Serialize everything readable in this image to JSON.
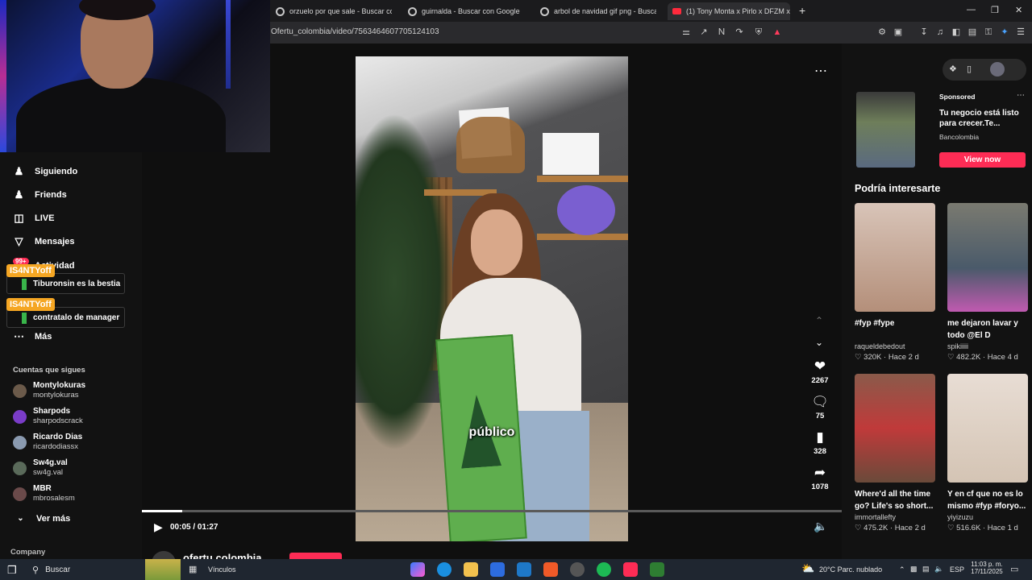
{
  "browser": {
    "tabs": [
      {
        "label": "orzuelo por que sale - Buscar con Go",
        "icon": "google-icon"
      },
      {
        "label": "guirnalda - Buscar con Google",
        "icon": "google-icon"
      },
      {
        "label": "arbol de navidad gif png - Buscar co",
        "icon": "google-icon"
      },
      {
        "label": "(1) Tony Monta x Pirlo x DFZM x Top",
        "icon": "youtube-icon"
      }
    ],
    "new_tab": "+",
    "url": "Ofertu_colombia/video/7563464607705124103"
  },
  "sidebar": {
    "nav": [
      {
        "label": "Siguiendo",
        "icon": "following-icon"
      },
      {
        "label": "Friends",
        "icon": "friends-icon"
      },
      {
        "label": "LIVE",
        "icon": "live-icon"
      },
      {
        "label": "Mensajes",
        "icon": "messages-icon"
      },
      {
        "label": "Actividad",
        "icon": "activity-icon",
        "badge": "99+"
      },
      {
        "label": "Más",
        "icon": "more-icon"
      }
    ],
    "following_label": "Cuentas que sigues",
    "following": [
      {
        "name": "Montylokuras",
        "handle": "montylokuras"
      },
      {
        "name": "Sharpods",
        "handle": "sharpodscrack"
      },
      {
        "name": "Ricardo Dias",
        "handle": "ricardodiassx"
      },
      {
        "name": "Sw4g.val",
        "handle": "sw4g.val"
      },
      {
        "name": "MBR",
        "handle": "mbrosalesm"
      }
    ],
    "see_more": "Ver más",
    "company": "Company"
  },
  "chat": [
    {
      "user": "IS4NTYoff",
      "message": "Tiburonsin es la bestia"
    },
    {
      "user": "IS4NTYoff",
      "message": "contratalo de manager"
    }
  ],
  "video": {
    "caption": "público",
    "current_time": "00:05",
    "duration": "01:27",
    "time_display": "00:05 / 01:27",
    "progress": 0.058,
    "creator": "ofertu.colombia"
  },
  "actions": {
    "likes": "2267",
    "comments": "75",
    "saves": "328",
    "shares": "1078"
  },
  "ad": {
    "sponsored": "Sponsored",
    "title": "Tu negocio está listo para crecer.Te...",
    "brand": "Bancolombia",
    "cta": "View now"
  },
  "recommendations": {
    "title": "Podría interesarte",
    "items": [
      {
        "title": "#fyp #fype",
        "author": "raqueldebedout",
        "likes": "320K",
        "age": "Hace 2 d"
      },
      {
        "title": "me dejaron lavar y todo @El D",
        "author": "spikiiiii",
        "likes": "482.2K",
        "age": "Hace 4 d"
      },
      {
        "title": "Where'd all the time go? Life's so short...",
        "author": "immortallefty",
        "likes": "475.2K",
        "age": "Hace 2 d"
      },
      {
        "title": "Y en cf que no es lo mismo #fyp #foryo...",
        "author": "yiyizuzu",
        "likes": "516.6K",
        "age": "Hace 1 d"
      }
    ]
  },
  "taskbar": {
    "search": "Buscar",
    "links": "Vínculos",
    "weather": "20°C  Parc. nublado",
    "lang": "ESP",
    "time": "11:03 p. m.",
    "date": "17/11/2025"
  },
  "colors": {
    "accent": "#fe2c55",
    "chat_tag": "#f5a623",
    "background": "#121212"
  }
}
